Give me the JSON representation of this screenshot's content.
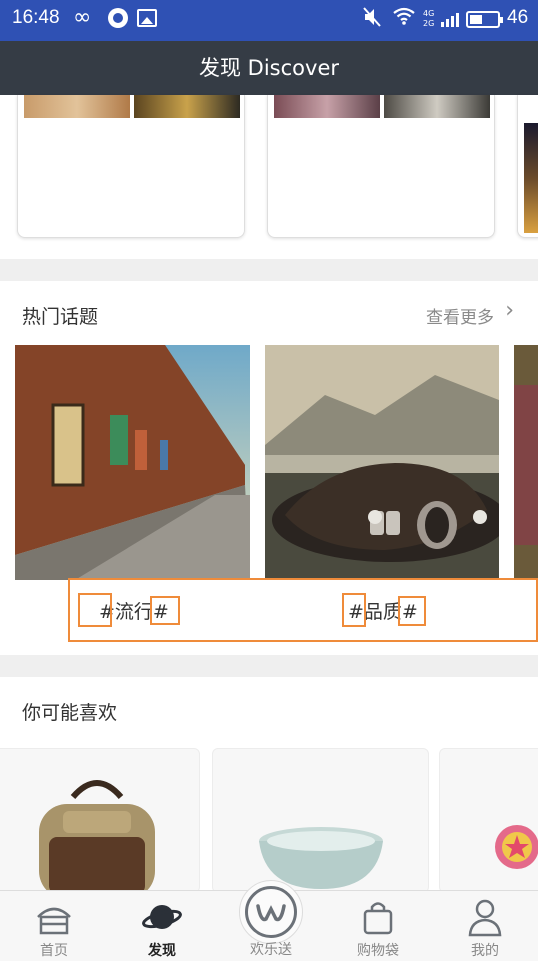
{
  "status_bar": {
    "time": "16:48",
    "infinity_glyph": "∞",
    "net_top": "4G",
    "net_bottom": "2G",
    "battery": "46",
    "battery_level": 0.46
  },
  "header": {
    "title": "发现 Discover"
  },
  "hot_topics": {
    "title": "热门话题",
    "more_label": "查看更多",
    "more_arrow": "›",
    "items": [
      {
        "label": "#流行#",
        "image": "brick-street-photo"
      },
      {
        "label": "#品质#",
        "image": "concept-car-photo"
      }
    ]
  },
  "recommend": {
    "title": "你可能喜欢",
    "items": [
      {
        "image": "backpack-photo"
      },
      {
        "image": "ceramic-bowl-photo"
      },
      {
        "image": "ring-photo"
      }
    ]
  },
  "tab_bar": {
    "tabs": [
      {
        "label": "首页",
        "icon": "home-icon"
      },
      {
        "label": "发现",
        "icon": "planet-icon",
        "active": true
      },
      {
        "label": "欢乐送",
        "icon": "w-logo-icon"
      },
      {
        "label": "购物袋",
        "icon": "bag-icon"
      },
      {
        "label": "我的",
        "icon": "person-icon"
      }
    ]
  },
  "colors": {
    "status_bar": "#2f51b4",
    "header": "#353c45",
    "highlight_box": "#ef8b3a"
  }
}
